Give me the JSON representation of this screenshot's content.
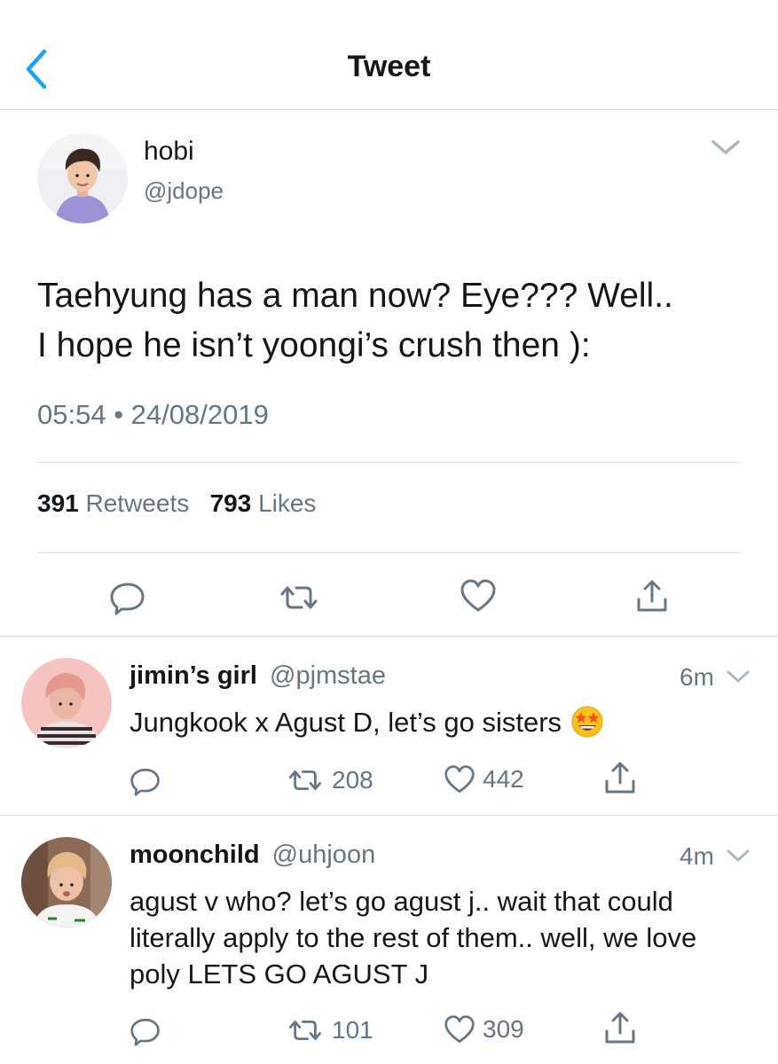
{
  "header": {
    "title": "Tweet"
  },
  "main_tweet": {
    "name": "hobi",
    "handle": "@jdope",
    "text_line1": "Taehyung has a man now? Eye??? Well..",
    "text_line2": "I hope he isn’t yoongi’s crush then ):",
    "timestamp": "05:54 • 24/08/2019",
    "retweets_count": "391",
    "retweets_label": "Retweets",
    "likes_count": "793",
    "likes_label": "Likes"
  },
  "replies": [
    {
      "name": "jimin’s girl",
      "handle": "@pjmstae",
      "time": "6m",
      "text": "Jungkook x Agust D, let’s go sisters",
      "emoji": "star-struck-emoji",
      "retweets": "208",
      "likes": "442"
    },
    {
      "name": "moonchild",
      "handle": "@uhjoon",
      "time": "4m",
      "text": "agust v who? let’s go agust j.. wait that could literally apply to the rest of them.. well, we love poly LETS GO AGUST J",
      "retweets": "101",
      "likes": "309"
    }
  ],
  "colors": {
    "accent": "#1da1f2",
    "text": "#14171a",
    "secondary": "#657786",
    "divider": "#d9dde0"
  },
  "icons": [
    "back-chevron-icon",
    "caret-down-icon",
    "reply-icon",
    "retweet-icon",
    "like-icon",
    "share-icon"
  ]
}
